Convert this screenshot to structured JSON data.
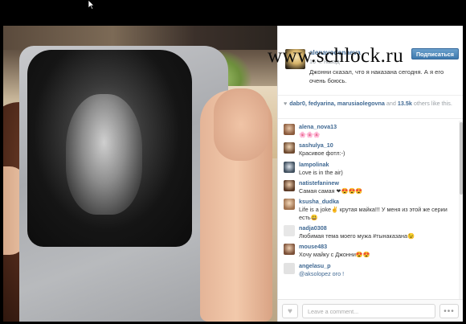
{
  "watermark": "www.schlock.ru",
  "post": {
    "owner": "alenavodonaeva",
    "time_ago": "16 ч. назад",
    "follow_label": "Подписаться",
    "caption": "Джонни сказал, что я наказана сегодня. А я его очень боюсь."
  },
  "likes": {
    "heart_icon": "♥",
    "users": "dabr0, fedyarina, marusiaolegovna",
    "and_word": "and",
    "count": "13.5k",
    "suffix": "others like this."
  },
  "comments": [
    {
      "user": "alena_nova13",
      "text": "🌸🌸🌸"
    },
    {
      "user": "sashulya_10",
      "text": "Красивое фотл:-)"
    },
    {
      "user": "lampolinak",
      "text": "Love is in the air)"
    },
    {
      "user": "natistefaninew",
      "text": "Самая самая ❤😍😍😍"
    },
    {
      "user": "ksusha_dudka",
      "text": "Life is a joke✌ крутая майка!!! У меня из этой же серии есть😃"
    },
    {
      "user": "nadja0308",
      "text": "Любимая тема моего мужа #тынаказана😉"
    },
    {
      "user": "mouse483",
      "text": "Хочу майку с Джонни😍😍"
    },
    {
      "user": "angelasu_p",
      "text": "@aksolopez ого !"
    }
  ],
  "footer": {
    "like_icon": "♥",
    "comment_placeholder": "Leave a comment...",
    "more_icon": "•••"
  },
  "colors": {
    "link": "#3f6892",
    "follow_button": "#4a84b8"
  }
}
